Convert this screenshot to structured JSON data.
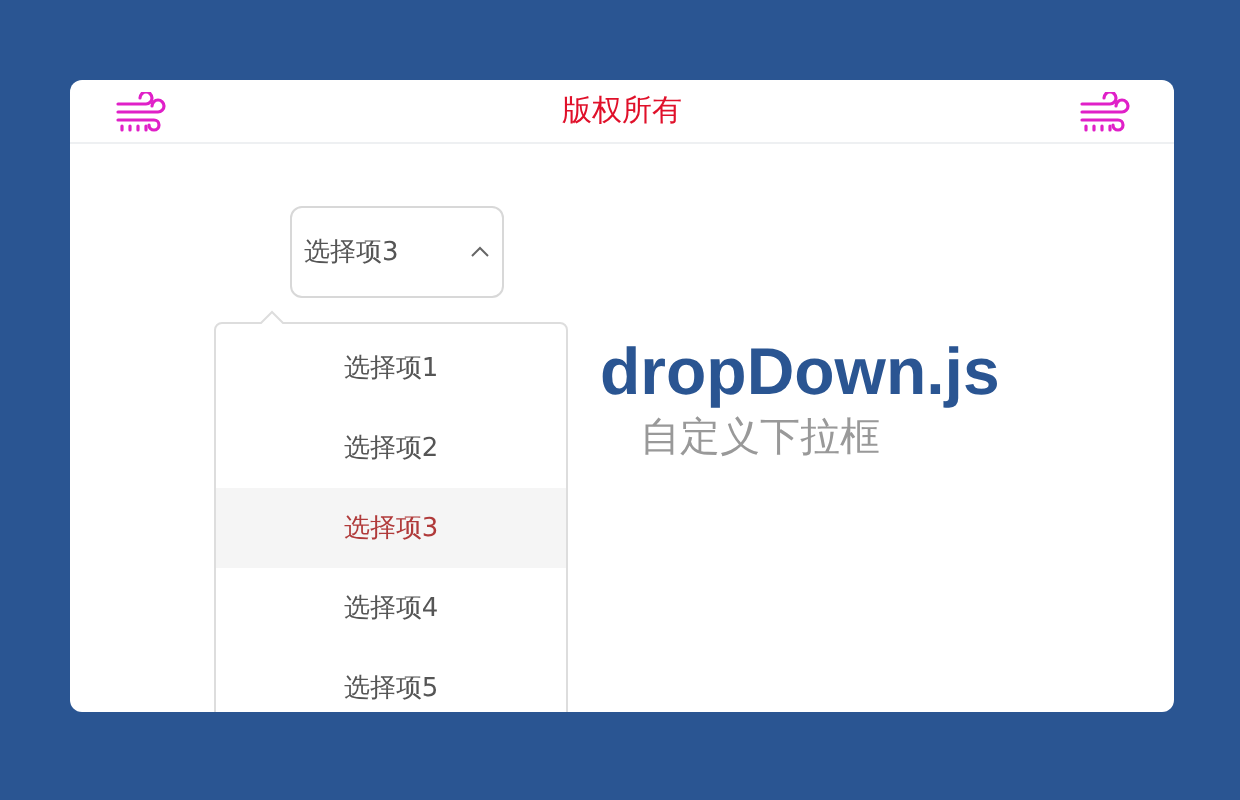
{
  "header": {
    "title": "版权所有"
  },
  "dropdown": {
    "value": "选择项3",
    "expanded": true,
    "options": [
      {
        "label": "选择项1",
        "selected": false
      },
      {
        "label": "选择项2",
        "selected": false
      },
      {
        "label": "选择项3",
        "selected": true
      },
      {
        "label": "选择项4",
        "selected": false
      },
      {
        "label": "选择项5",
        "selected": false
      }
    ]
  },
  "heading": {
    "title": "dropDown.js",
    "subtitle": "自定义下拉框"
  }
}
